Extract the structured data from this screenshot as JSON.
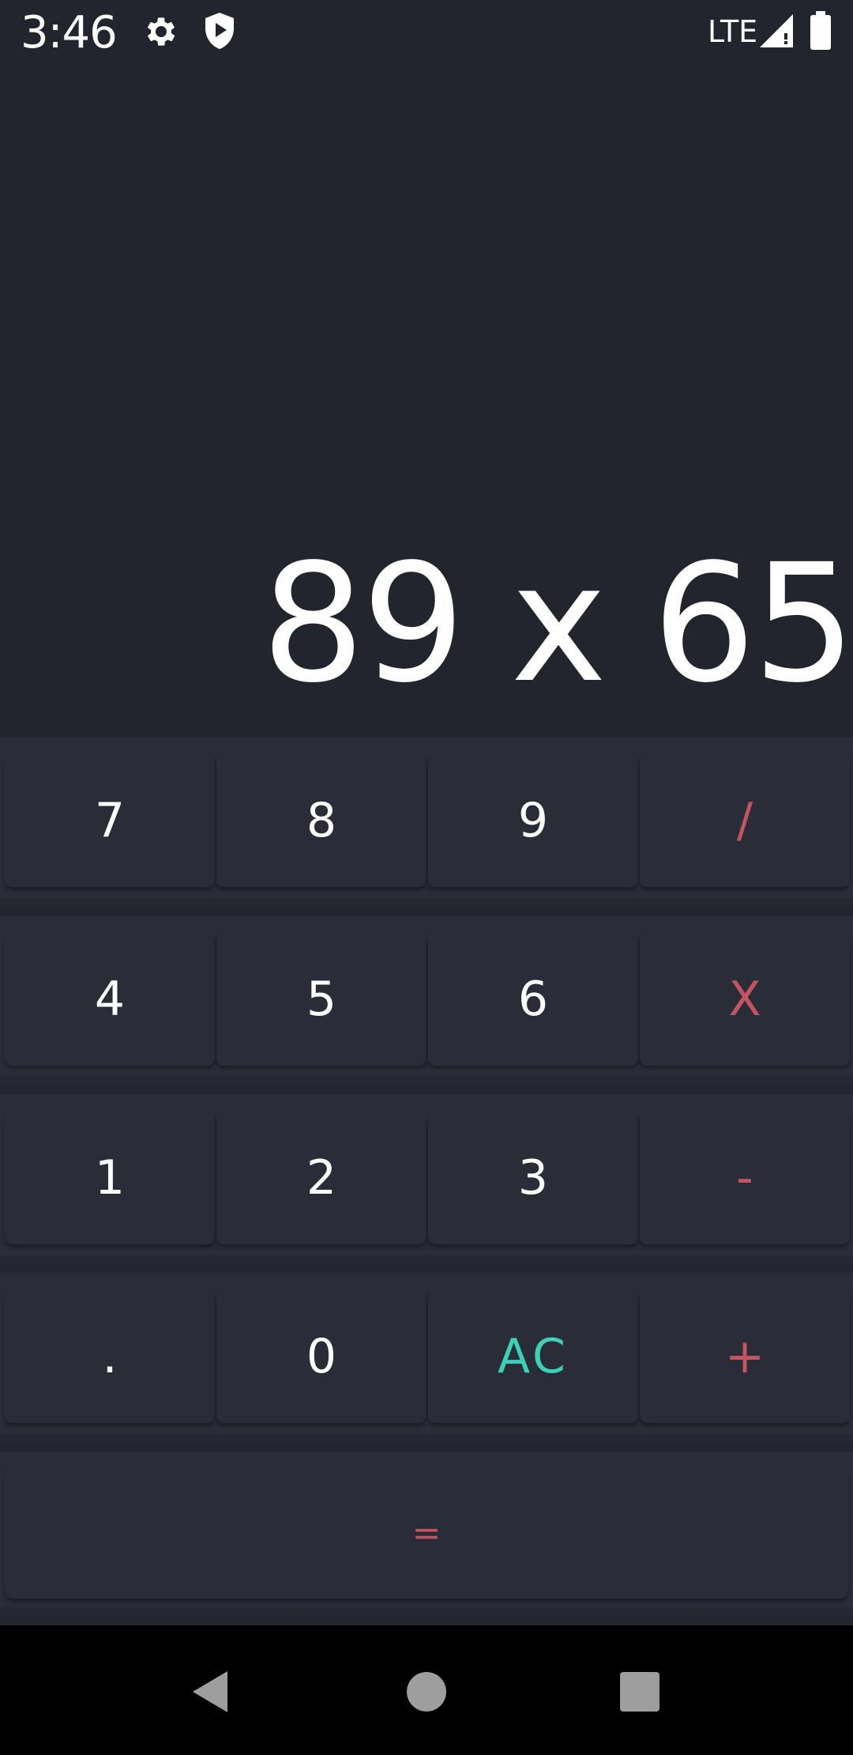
{
  "status_bar": {
    "time": "3:46",
    "network": "LTE",
    "icons": [
      "gear-icon",
      "shield-play-icon",
      "signal-icon",
      "battery-icon"
    ]
  },
  "display": {
    "expression": "89 x 65"
  },
  "keypad": {
    "row1": [
      "7",
      "8",
      "9",
      "/"
    ],
    "row2": [
      "4",
      "5",
      "6",
      "X"
    ],
    "row3": [
      "1",
      "2",
      "3",
      "-"
    ],
    "row4": [
      ".",
      "0",
      "AC",
      "+"
    ],
    "equals": "="
  },
  "nav_bar": {
    "icons": [
      "back-icon",
      "home-icon",
      "recents-icon"
    ]
  },
  "colors": {
    "background": "#22252e",
    "key": "#2a2d37",
    "operator": "#c2555f",
    "clear": "#3ed1b7",
    "text": "#ffffff"
  }
}
